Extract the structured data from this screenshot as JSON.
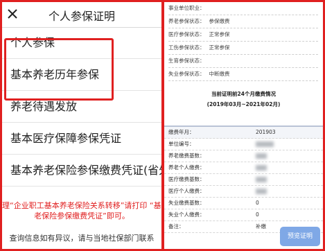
{
  "left": {
    "title": "个人参保证明",
    "menu": [
      {
        "label": "个人参保"
      },
      {
        "label": "基本养老历年参保"
      },
      {
        "label": "养老待遇发放"
      },
      {
        "label": "基本医疗保障参保凭证"
      },
      {
        "label": "基本养老保险参保缴费凭证(省外)"
      }
    ],
    "notice_line1": "理“企业职工基本养老保险关系转移”请打印 “基本",
    "notice_line2": "老保险参保缴费凭证”即可。",
    "bottom_note": "查询信息如有异议，请与当地社保部门联系"
  },
  "right": {
    "top_lines": [
      {
        "label": "事业单位职业：",
        "value": ""
      },
      {
        "label": "养老参保状态：",
        "value": "参保缴费"
      },
      {
        "label": "医疗参保状态：",
        "value": "正常参保"
      },
      {
        "label": "工伤参保状态：",
        "value": "正常参保"
      },
      {
        "label": "生育参保状态：",
        "value": ""
      },
      {
        "label": "失业参保状态：",
        "value": "中断缴费"
      }
    ],
    "summary_line1": "当前证明前24个月缴费情况",
    "summary_line2": "(2019年03月~2021年02月)",
    "rows": [
      {
        "label": "缴费年月：",
        "value": "201903"
      },
      {
        "label": "单位编号：",
        "value": ""
      },
      {
        "label": "养老缴费基数：",
        "value": ""
      },
      {
        "label": "养老个人缴费：",
        "value": ""
      },
      {
        "label": "医疗缴费基数：",
        "value": ""
      },
      {
        "label": "医疗个人缴费：",
        "value": ""
      },
      {
        "label": "失业缴费基数：",
        "value": "0"
      },
      {
        "label": "失业个人缴费：",
        "value": "0"
      },
      {
        "label": "备注：",
        "value": "补缴"
      }
    ],
    "print_button": "预览证明"
  },
  "colors": {
    "highlight": "#e02020",
    "button": "#7fa8e6"
  }
}
